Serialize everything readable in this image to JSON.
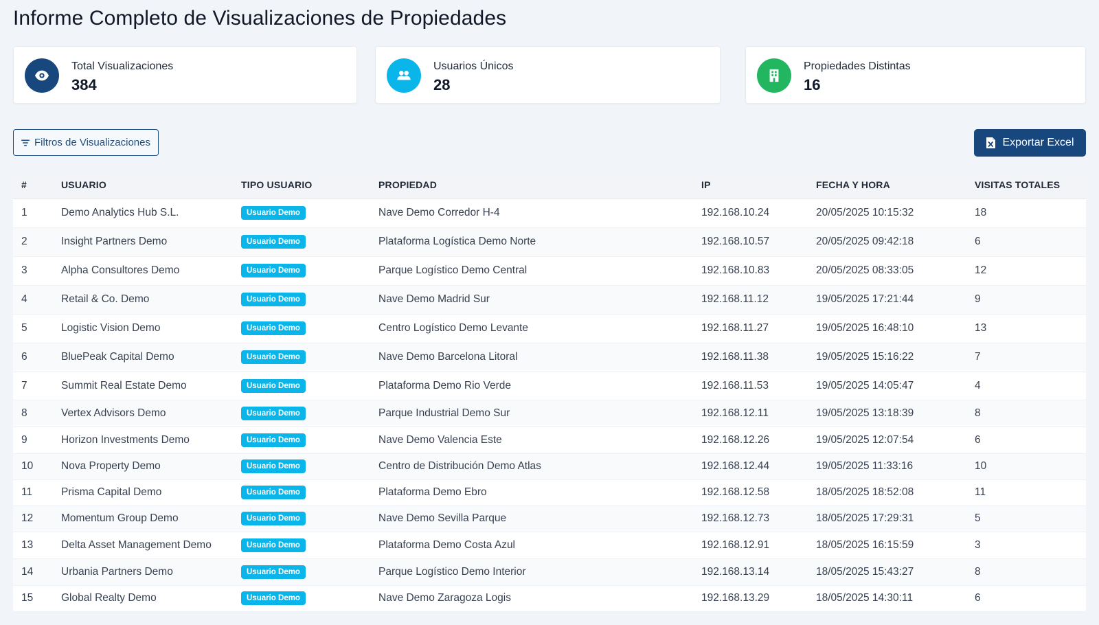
{
  "page": {
    "title": "Informe Completo de Visualizaciones de Propiedades"
  },
  "stats": [
    {
      "label": "Total Visualizaciones",
      "value": "384",
      "icon": "eye-icon",
      "color": "#17477d"
    },
    {
      "label": "Usuarios Únicos",
      "value": "28",
      "icon": "users-icon",
      "color": "#0ab5ea"
    },
    {
      "label": "Propiedades Distintas",
      "value": "16",
      "icon": "building-icon",
      "color": "#22b661"
    }
  ],
  "toolbar": {
    "filters_label": "Filtros de Visualizaciones",
    "export_label": "Exportar Excel"
  },
  "table": {
    "columns": [
      "#",
      "USUARIO",
      "TIPO USUARIO",
      "PROPIEDAD",
      "IP",
      "FECHA Y HORA",
      "VISITAS TOTALES"
    ],
    "rows": [
      [
        "1",
        "Demo Analytics Hub S.L.",
        "Usuario Demo",
        "Nave Demo Corredor H-4",
        "192.168.10.24",
        "20/05/2025 10:15:32",
        "18"
      ],
      [
        "2",
        "Insight Partners Demo",
        "Usuario Demo",
        "Plataforma Logística Demo Norte",
        "192.168.10.57",
        "20/05/2025 09:42:18",
        "6"
      ],
      [
        "3",
        "Alpha Consultores Demo",
        "Usuario Demo",
        "Parque Logístico Demo Central",
        "192.168.10.83",
        "20/05/2025 08:33:05",
        "12"
      ],
      [
        "4",
        "Retail & Co. Demo",
        "Usuario Demo",
        "Nave Demo Madrid Sur",
        "192.168.11.12",
        "19/05/2025 17:21:44",
        "9"
      ],
      [
        "5",
        "Logistic Vision Demo",
        "Usuario Demo",
        "Centro Logístico Demo Levante",
        "192.168.11.27",
        "19/05/2025 16:48:10",
        "13"
      ],
      [
        "6",
        "BluePeak Capital Demo",
        "Usuario Demo",
        "Nave Demo Barcelona Litoral",
        "192.168.11.38",
        "19/05/2025 15:16:22",
        "7"
      ],
      [
        "7",
        "Summit Real Estate Demo",
        "Usuario Demo",
        "Plataforma Demo Rio Verde",
        "192.168.11.53",
        "19/05/2025 14:05:47",
        "4"
      ],
      [
        "8",
        "Vertex Advisors Demo",
        "Usuario Demo",
        "Parque Industrial Demo Sur",
        "192.168.12.11",
        "19/05/2025 13:18:39",
        "8"
      ],
      [
        "9",
        "Horizon Investments Demo",
        "Usuario Demo",
        "Nave Demo Valencia Este",
        "192.168.12.26",
        "19/05/2025 12:07:54",
        "6"
      ],
      [
        "10",
        "Nova Property Demo",
        "Usuario Demo",
        "Centro de Distribución Demo Atlas",
        "192.168.12.44",
        "19/05/2025 11:33:16",
        "10"
      ],
      [
        "11",
        "Prisma Capital Demo",
        "Usuario Demo",
        "Plataforma Demo Ebro",
        "192.168.12.58",
        "18/05/2025 18:52:08",
        "11"
      ],
      [
        "12",
        "Momentum Group Demo",
        "Usuario Demo",
        "Nave Demo Sevilla Parque",
        "192.168.12.73",
        "18/05/2025 17:29:31",
        "5"
      ],
      [
        "13",
        "Delta Asset Management Demo",
        "Usuario Demo",
        "Plataforma Demo Costa Azul",
        "192.168.12.91",
        "18/05/2025 16:15:59",
        "3"
      ],
      [
        "14",
        "Urbania Partners Demo",
        "Usuario Demo",
        "Parque Logístico Demo Interior",
        "192.168.13.14",
        "18/05/2025 15:43:27",
        "8"
      ],
      [
        "15",
        "Global Realty Demo",
        "Usuario Demo",
        "Nave Demo Zaragoza Logis",
        "192.168.13.29",
        "18/05/2025 14:30:11",
        "6"
      ]
    ]
  }
}
